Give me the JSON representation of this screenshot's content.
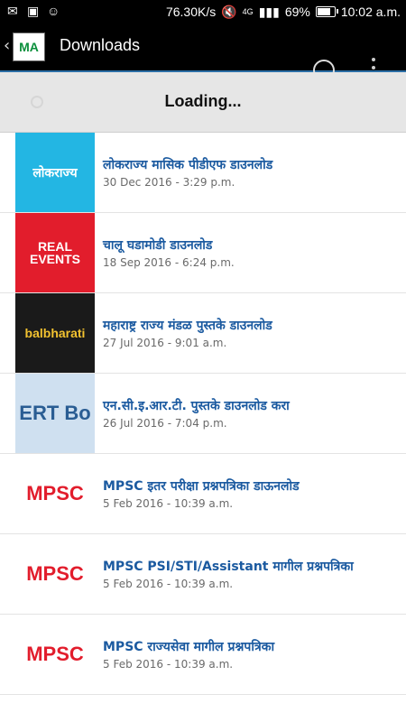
{
  "status_bar": {
    "net_speed": "76.30K/s",
    "network": "4G",
    "battery": "69%",
    "battery_level": 0.69,
    "time": "10:02 a.m."
  },
  "app_bar": {
    "title": "Downloads",
    "logo_text": "MA"
  },
  "loading": {
    "text": "Loading..."
  },
  "items": [
    {
      "title": "लोकराज्य मासिक पीडीएफ डाउनलोड",
      "date": "30 Dec 2016 - 3:29 p.m.",
      "thumb_text": "लोकराज्य",
      "thumb_bg": "#23b6e3",
      "thumb_fg": "#ffffff"
    },
    {
      "title": "चालू घडामोडी डाउनलोड",
      "date": "18 Sep 2016 - 6:24 p.m.",
      "thumb_text": "REAL EVENTS",
      "thumb_bg": "#e21d2c",
      "thumb_fg": "#ffffff"
    },
    {
      "title": "महाराष्ट्र राज्य मंडळ पुस्तके डाउनलोड",
      "date": "27 Jul 2016 - 9:01 a.m.",
      "thumb_text": "balbharati",
      "thumb_bg": "#1a1a1a",
      "thumb_fg": "#f2c230"
    },
    {
      "title": "एन.सी.इ.आर.टी. पुस्तके डाउनलोड करा",
      "date": "26 Jul 2016 - 7:04 p.m.",
      "thumb_text": "ERT Bo",
      "thumb_bg": "#cfe0f0",
      "thumb_fg": "#2a5d93"
    },
    {
      "title": "MPSC इतर परीक्षा प्रश्नपत्रिका डाऊनलोड",
      "date": "5 Feb 2016 - 10:39 a.m.",
      "thumb_text": "MPSC",
      "thumb_bg": "#ffffff",
      "thumb_fg": "#e21d2c"
    },
    {
      "title": "MPSC PSI/STI/Assistant मागील प्रश्नपत्रिका",
      "date": "5 Feb 2016 - 10:39 a.m.",
      "thumb_text": "MPSC",
      "thumb_bg": "#ffffff",
      "thumb_fg": "#e21d2c"
    },
    {
      "title": "MPSC राज्यसेवा मागील प्रश्नपत्रिका",
      "date": "5 Feb 2016 - 10:39 a.m.",
      "thumb_text": "MPSC",
      "thumb_bg": "#ffffff",
      "thumb_fg": "#e21d2c"
    }
  ]
}
